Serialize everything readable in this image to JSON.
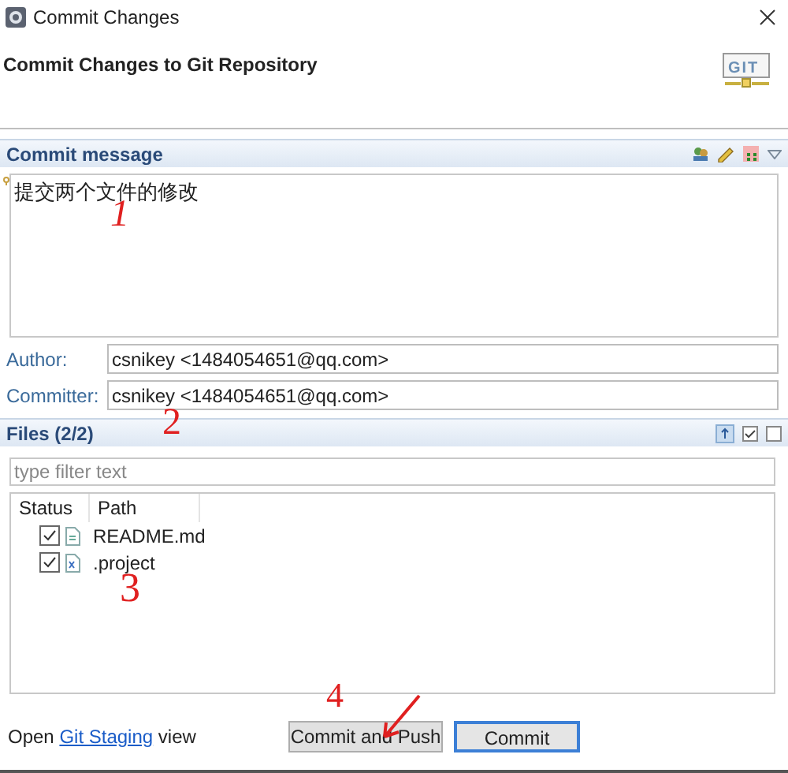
{
  "window": {
    "title": "Commit Changes"
  },
  "header": {
    "title": "Commit Changes to Git Repository",
    "logo_text": "GIT"
  },
  "commit_message": {
    "title": "Commit message",
    "value": "提交两个文件的修改"
  },
  "author": {
    "label": "Author:",
    "value": "csnikey <1484054651@qq.com>"
  },
  "committer": {
    "label": "Committer:",
    "value": "csnikey <1484054651@qq.com>"
  },
  "files": {
    "title": "Files (2/2)",
    "filter_placeholder": "type filter text",
    "columns": [
      "Status",
      "Path"
    ],
    "rows": [
      {
        "path": "README.md",
        "checked": true,
        "kind": "text"
      },
      {
        "path": ".project",
        "checked": true,
        "kind": "xml"
      }
    ]
  },
  "footer": {
    "prefix": "Open",
    "link": "Git Staging",
    "suffix": "view",
    "buttons": [
      {
        "label": "Commit and Push",
        "default": false
      },
      {
        "label": "Commit",
        "default": true
      }
    ]
  },
  "annotations": [
    "1",
    "2",
    "3",
    "4"
  ]
}
